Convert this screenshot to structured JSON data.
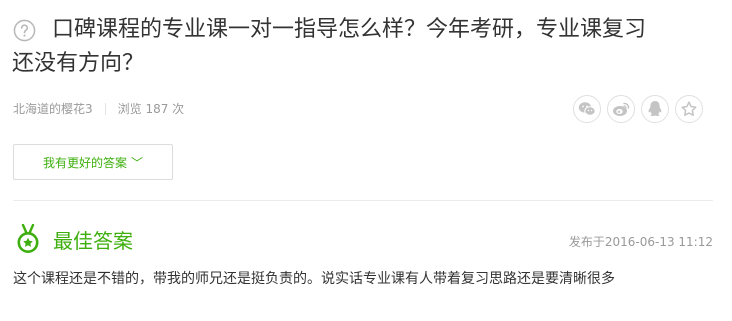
{
  "question": {
    "title_line1": "口碑课程的专业课一对一指导怎么样？今年考研，专业课复习",
    "title_line2": "还没有方向？"
  },
  "meta": {
    "author": "北海道的樱花3",
    "views": "浏览 187 次"
  },
  "share": {
    "icons": [
      "wechat-icon",
      "weibo-icon",
      "qq-icon",
      "favorite-icon"
    ]
  },
  "actions": {
    "better_answer_label": "我有更好的答案",
    "chevron": "﹀"
  },
  "best_answer": {
    "title": "最佳答案",
    "published": "发布于2016-06-13 11:12",
    "text": "这个课程还是不错的，带我的师兄还是挺负责的。说实话专业课有人带着复习思路还是要清晰很多"
  },
  "colors": {
    "accent_green": "#3eaf0e",
    "text_gray": "#9a9a9a"
  }
}
